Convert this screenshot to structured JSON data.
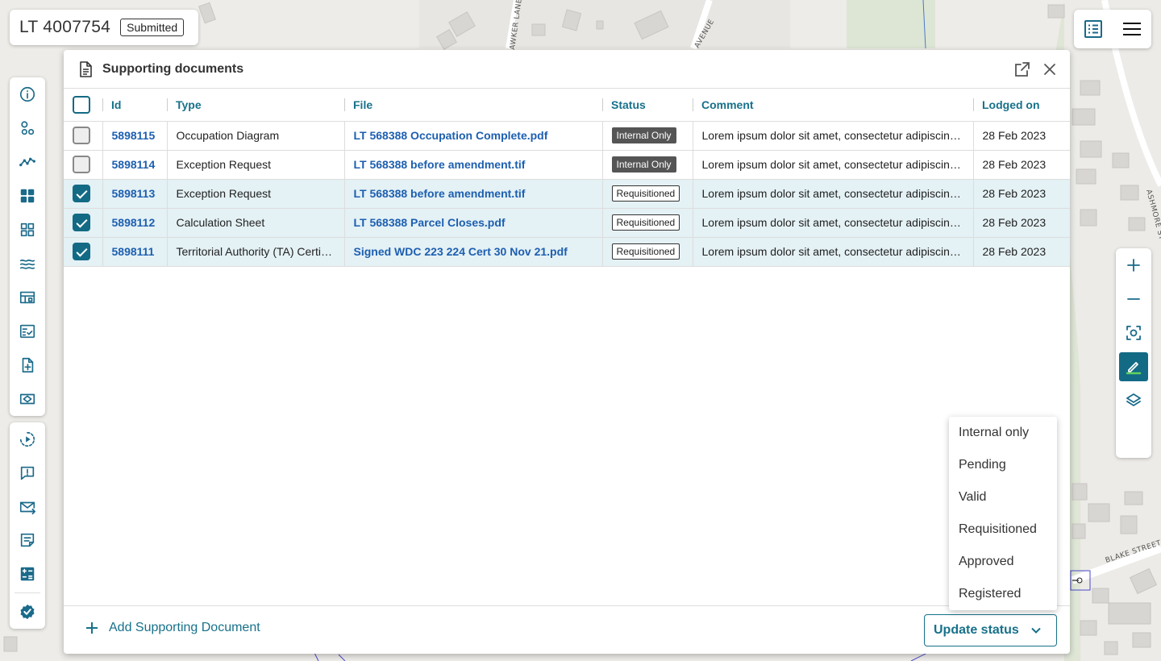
{
  "header": {
    "title": "LT 4007754",
    "status_badge": "Submitted"
  },
  "map": {
    "street_labels": [
      "AWKER LANE",
      "AVENUE",
      "ASHMORE ST",
      "BLAKE STREET"
    ]
  },
  "left_toolbar": {
    "top_icons": [
      "info-icon",
      "parcels-icon",
      "traverse-icon",
      "dashboard-icon",
      "grid-icon",
      "water-icon",
      "layout-icon",
      "checklist-icon",
      "add-document-icon",
      "survey-icon"
    ],
    "bottom_icons": [
      "timeline-icon",
      "comment-alert-icon",
      "email-icon",
      "notes-icon",
      "calculator-icon",
      "verified-icon"
    ]
  },
  "top_right": {
    "icons": [
      "list-view-icon",
      "menu-icon"
    ]
  },
  "map_controls": {
    "icons": [
      "zoom-in-icon",
      "zoom-out-icon",
      "zoom-extent-icon",
      "draw-icon",
      "layers-icon"
    ]
  },
  "panel": {
    "title": "Supporting documents",
    "columns": [
      "Id",
      "Type",
      "File",
      "Status",
      "Comment",
      "Lodged on"
    ],
    "rows": [
      {
        "id": "5898115",
        "type": "Occupation Diagram",
        "file": "LT 568388 Occupation Complete.pdf",
        "status": "Internal Only",
        "comment": "Lorem ipsum dolor sit amet, consectetur adipiscing elit",
        "lodged": "28 Feb 2023",
        "checked": false
      },
      {
        "id": "5898114",
        "type": "Exception Request",
        "file": "LT 568388 before amendment.tif",
        "status": "Internal Only",
        "comment": "Lorem ipsum dolor sit amet, consectetur adipiscing elit",
        "lodged": "28 Feb 2023",
        "checked": false
      },
      {
        "id": "5898113",
        "type": "Exception Request",
        "file": "LT 568388 before amendment.tif",
        "status": "Requisitioned",
        "comment": "Lorem ipsum dolor sit amet, consectetur adipiscing elit",
        "lodged": "28 Feb 2023",
        "checked": true
      },
      {
        "id": "5898112",
        "type": "Calculation Sheet",
        "file": "LT 568388 Parcel Closes.pdf",
        "status": "Requisitioned",
        "comment": "Lorem ipsum dolor sit amet, consectetur adipiscing elit",
        "lodged": "28 Feb 2023",
        "checked": true
      },
      {
        "id": "5898111",
        "type": "Territorial Authority (TA) Certificate",
        "file": "Signed WDC 223 224 Cert 30 Nov 21.pdf",
        "status": "Requisitioned",
        "comment": "Lorem ipsum dolor sit amet, consectetur adipiscing elit",
        "lodged": "28 Feb 2023",
        "checked": true
      }
    ],
    "footer": {
      "add_label": "Add Supporting Document",
      "update_label": "Update status"
    }
  },
  "status_menu": {
    "options": [
      "Internal only",
      "Pending",
      "Valid",
      "Requisitioned",
      "Approved",
      "Registered"
    ]
  },
  "colors": {
    "accent": "#136a85",
    "link": "#1d5fb0",
    "selected_row": "#e4f1f5"
  }
}
